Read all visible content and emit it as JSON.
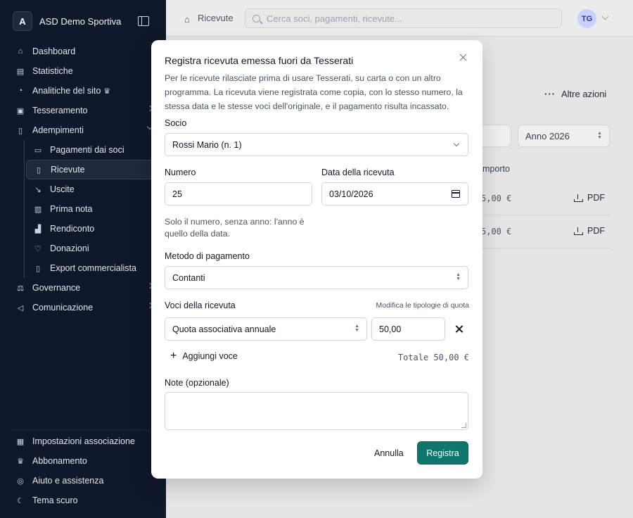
{
  "sidebar": {
    "brand_initial": "A",
    "brand_name": "ASD Demo Sportiva",
    "items": [
      {
        "label": "Dashboard"
      },
      {
        "label": "Statistiche"
      },
      {
        "label": "Analitiche del sito"
      },
      {
        "label": "Tesseramento"
      },
      {
        "label": "Adempimenti"
      }
    ],
    "sub_items": [
      {
        "label": "Pagamenti dai soci"
      },
      {
        "label": "Ricevute"
      },
      {
        "label": "Uscite"
      },
      {
        "label": "Prima nota"
      },
      {
        "label": "Rendiconto"
      },
      {
        "label": "Donazioni"
      },
      {
        "label": "Export commercialista"
      }
    ],
    "items_after": [
      {
        "label": "Governance"
      },
      {
        "label": "Comunicazione"
      }
    ],
    "bottom": [
      {
        "label": "Impostazioni associazione"
      },
      {
        "label": "Abbonamento"
      },
      {
        "label": "Aiuto e assistenza"
      },
      {
        "label": "Tema scuro"
      }
    ]
  },
  "topbar": {
    "breadcrumb": "Ricevute",
    "search_placeholder": "Cerca soci, pagamenti, ricevute...",
    "avatar_initials": "TG"
  },
  "background": {
    "more_actions": "Altre azioni",
    "year_filter": "Anno 2026",
    "column_importo": "mporto",
    "rows": [
      {
        "amount": "5,00 €",
        "pdf": "PDF"
      },
      {
        "amount": "5,00 €",
        "pdf": "PDF"
      }
    ]
  },
  "modal": {
    "title": "Registra ricevuta emessa fuori da Tesserati",
    "description": "Per le ricevute rilasciate prima di usare Tesserati, su carta o con un altro programma. La ricevuta viene registrata come copia, con lo stesso numero, la stessa data e le stesse voci dell'originale, e il pagamento risulta incassato.",
    "socio_label": "Socio",
    "socio_value": "Rossi Mario (n. 1)",
    "numero_label": "Numero",
    "numero_value": "25",
    "data_label": "Data della ricevuta",
    "data_value": "03/10/2026",
    "numero_hint": "Solo il numero, senza anno: l'anno è quello della data.",
    "metodo_label": "Metodo di pagamento",
    "metodo_value": "Contanti",
    "voci_label": "Voci della ricevuta",
    "voci_link": "Modifica le tipologie di quota",
    "voce_tipo": "Quota associativa annuale",
    "voce_importo": "50,00",
    "add_voce": "Aggiungi voce",
    "totale": "Totale 50,00 €",
    "note_label": "Note (opzionale)",
    "cancel": "Annulla",
    "submit": "Registra"
  },
  "colors": {
    "sidebar_bg": "#0f172a",
    "primary": "#0f766e"
  }
}
